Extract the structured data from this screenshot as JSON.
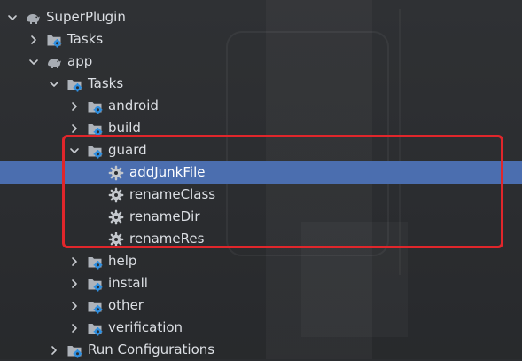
{
  "tree": {
    "root": {
      "label": "SuperPlugin",
      "icon": "gradle-elephant-icon",
      "expanded": true
    },
    "root_tasks": {
      "label": "Tasks",
      "icon": "folder-gear-icon"
    },
    "app": {
      "label": "app",
      "icon": "gradle-elephant-icon",
      "expanded": true
    },
    "app_tasks": {
      "label": "Tasks",
      "icon": "folder-gear-icon",
      "expanded": true
    },
    "groups_before": [
      {
        "label": "android"
      },
      {
        "label": "build"
      }
    ],
    "guard": {
      "label": "guard",
      "expanded": true
    },
    "guard_tasks": [
      {
        "label": "addJunkFile",
        "selected": true
      },
      {
        "label": "renameClass"
      },
      {
        "label": "renameDir"
      },
      {
        "label": "renameRes"
      }
    ],
    "groups_after": [
      {
        "label": "help"
      },
      {
        "label": "install"
      },
      {
        "label": "other"
      },
      {
        "label": "verification"
      }
    ],
    "run_configurations": {
      "label": "Run Configurations"
    }
  },
  "colors": {
    "background": "#2b2d30",
    "selection": "#4b6eaf",
    "highlight_box": "#e0262b",
    "text": "#dcdfe4",
    "gear": "#4a8fd6"
  }
}
